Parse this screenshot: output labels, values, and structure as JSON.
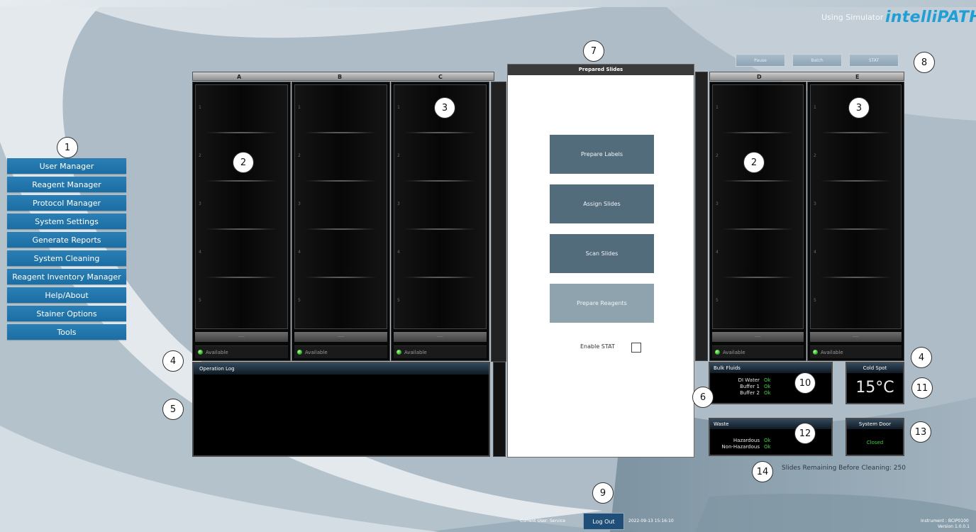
{
  "header": {
    "using_simulator": "Using Simulator",
    "logo": "intelliPATH",
    "controls": [
      {
        "label": "Pause"
      },
      {
        "label": "Batch"
      },
      {
        "label": "STAT"
      }
    ]
  },
  "menu": {
    "items": [
      {
        "label": "User Manager"
      },
      {
        "label": "Reagent Manager"
      },
      {
        "label": "Protocol Manager"
      },
      {
        "label": "System Settings"
      },
      {
        "label": "Generate Reports"
      },
      {
        "label": "System Cleaning"
      },
      {
        "label": "Reagent Inventory Manager"
      },
      {
        "label": "Help/About"
      },
      {
        "label": "Stainer Options"
      },
      {
        "label": "Tools"
      }
    ]
  },
  "racks": [
    {
      "letter": "A",
      "status": "Available",
      "slots": [
        "1",
        "2",
        "3",
        "4",
        "5"
      ],
      "bottom": "----"
    },
    {
      "letter": "B",
      "status": "Available",
      "slots": [
        "1",
        "2",
        "3",
        "4",
        "5"
      ],
      "bottom": "----"
    },
    {
      "letter": "C",
      "status": "Available",
      "slots": [
        "1",
        "2",
        "3",
        "4",
        "5"
      ],
      "bottom": "----"
    },
    {
      "letter": "D",
      "status": "Available",
      "slots": [
        "1",
        "2",
        "3",
        "4",
        "5"
      ],
      "bottom": "----"
    },
    {
      "letter": "E",
      "status": "Available",
      "slots": [
        "1",
        "2",
        "3",
        "4",
        "5"
      ],
      "bottom": "----"
    }
  ],
  "prepared_slides": {
    "title": "Prepared Slides",
    "buttons": [
      {
        "label": "Prepare Labels"
      },
      {
        "label": "Assign Slides"
      },
      {
        "label": "Scan Slides"
      },
      {
        "label": "Prepare Reagents"
      }
    ],
    "enable_stat": "Enable STAT",
    "enable_stat_checked": false
  },
  "operation_log": {
    "title": "Operation Log"
  },
  "bulk_fluids": {
    "title": "Bulk Fluids",
    "items": [
      {
        "name": "DI Water",
        "status": "Ok"
      },
      {
        "name": "Buffer 1",
        "status": "Ok"
      },
      {
        "name": "Buffer 2",
        "status": "Ok"
      }
    ]
  },
  "waste": {
    "title": "Waste",
    "items": [
      {
        "name": "Hazardous",
        "status": "Ok"
      },
      {
        "name": "Non-Hazardous",
        "status": "Ok"
      }
    ]
  },
  "cold_spot": {
    "title": "Cold Spot",
    "value": "15°C"
  },
  "system_door": {
    "title": "System Door",
    "status": "Closed"
  },
  "slides_remaining": "Slides Remaining Before Cleaning:  250",
  "footer": {
    "current_user": "Current User:  Service",
    "logout": "Log Out",
    "datetime": "2022-09-13 15:16:10",
    "instrument": "Instrument : BCIP0100",
    "version": "Version 1.0.0.1"
  },
  "callouts": [
    "1",
    "2",
    "3",
    "2",
    "3",
    "4",
    "4",
    "5",
    "6",
    "7",
    "8",
    "9",
    "10",
    "11",
    "12",
    "13",
    "14"
  ],
  "colors": {
    "menu": "#1b6ea3",
    "status_ok": "#3fd33f",
    "logo": "#1f9fd6",
    "prep_button": "#526c7c"
  }
}
